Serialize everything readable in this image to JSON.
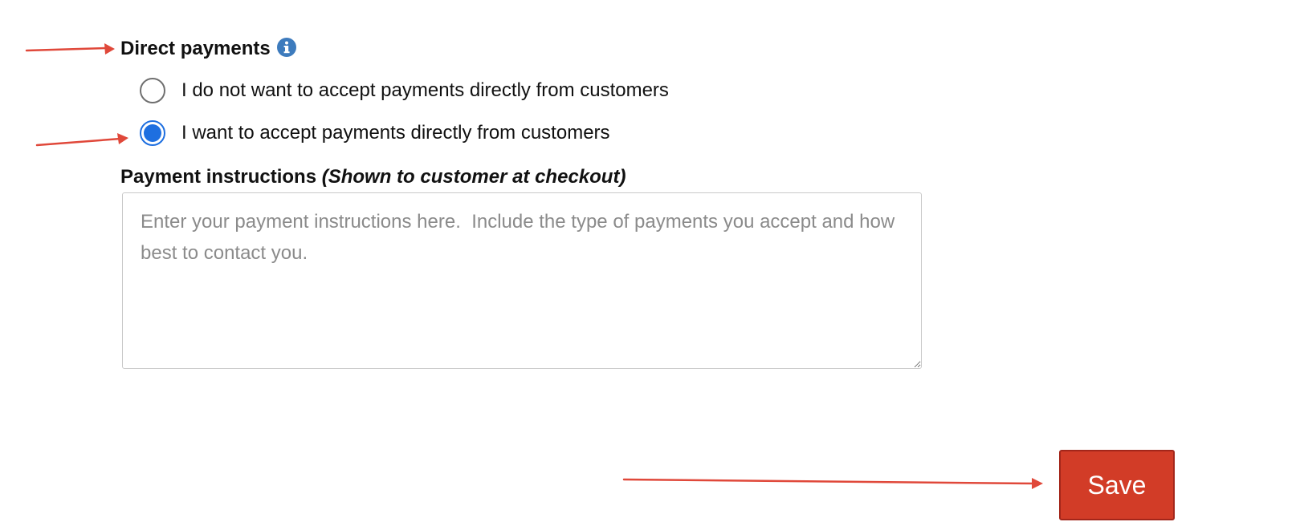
{
  "direct_payments": {
    "title": "Direct payments",
    "info_icon": "info-circle-icon",
    "options": [
      {
        "label": "I do not want to accept payments directly from customers",
        "selected": false
      },
      {
        "label": "I want to accept payments directly from customers",
        "selected": true
      }
    ]
  },
  "payment_instructions": {
    "label": "Payment instructions",
    "hint": "(Shown to customer at checkout)",
    "value": "",
    "placeholder": "Enter your payment instructions here.  Include the type of payments you accept and how best to contact you."
  },
  "actions": {
    "save_label": "Save"
  },
  "annotations": {
    "arrow_icon": "red-annotation-arrow-icon",
    "arrow_color": "#e0483a"
  },
  "colors": {
    "radio_selected": "#1e6fe0",
    "info_icon": "#3d7bbd",
    "save_button": "#d23c27"
  }
}
